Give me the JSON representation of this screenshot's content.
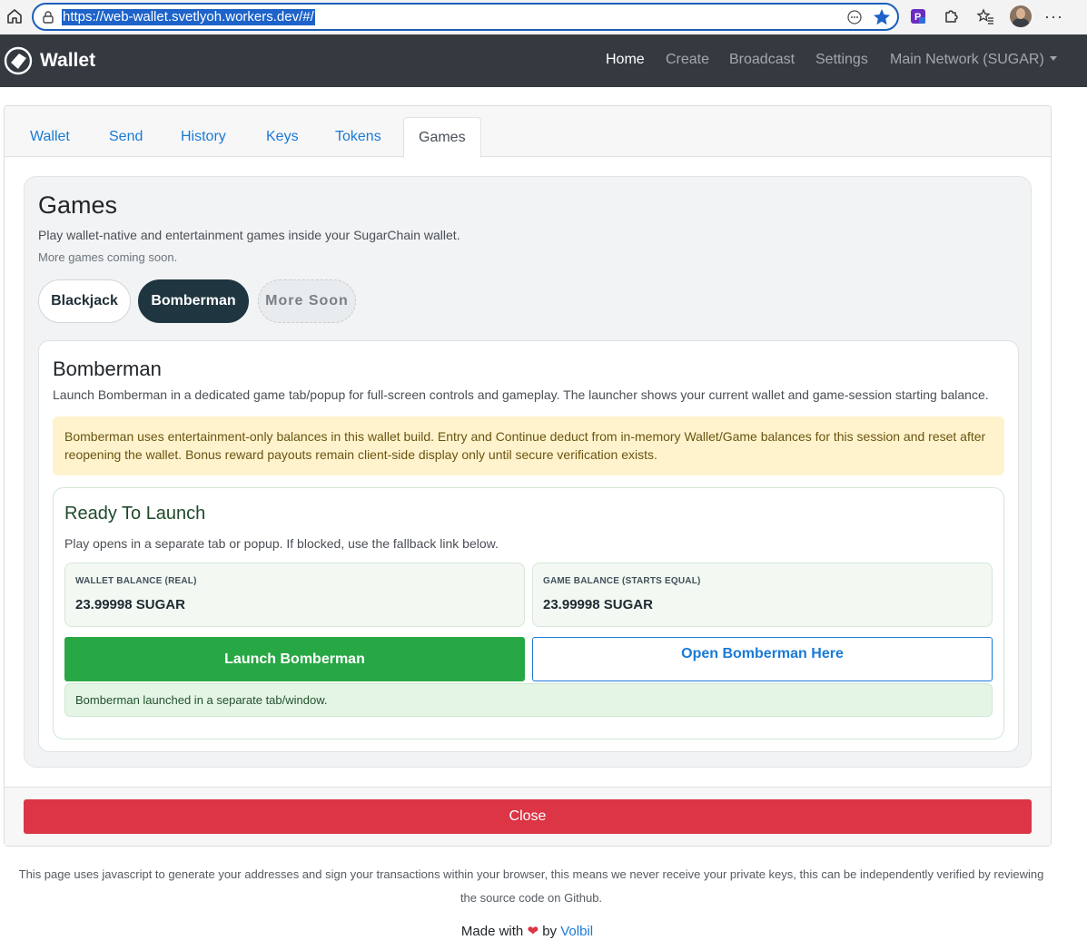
{
  "browser": {
    "url": "https://web-wallet.svetlyoh.workers.dev/#/",
    "icons": [
      "home-icon",
      "lock-icon",
      "reader-icon",
      "favorite-star-icon",
      "extension-p-icon",
      "puzzle-icon",
      "favorites-icon",
      "profile-avatar",
      "more-icon"
    ],
    "more_label": "···"
  },
  "navbar": {
    "brand": "Wallet",
    "items": [
      "Home",
      "Create",
      "Broadcast",
      "Settings"
    ],
    "network": "Main Network (SUGAR)"
  },
  "tabs": [
    "Wallet",
    "Send",
    "History",
    "Keys",
    "Tokens",
    "Games"
  ],
  "games": {
    "title": "Games",
    "subtitle": "Play wallet-native and entertainment games inside your SugarChain wallet.",
    "note": "More games coming soon.",
    "pills": [
      "Blackjack",
      "Bomberman",
      "More Soon"
    ]
  },
  "bomberman": {
    "title": "Bomberman",
    "description": "Launch Bomberman in a dedicated game tab/popup for full-screen controls and gameplay. The launcher shows your current wallet and game-session starting balance.",
    "warning": "Bomberman uses entertainment-only balances in this wallet build. Entry and Continue deduct from in-memory Wallet/Game balances for this session and reset after reopening the wallet. Bonus reward payouts remain client-side display only until secure verification exists.",
    "launch": {
      "title": "Ready To Launch",
      "subtitle": "Play opens in a separate tab or popup. If blocked, use the fallback link below.",
      "wallet_balance_label": "Wallet Balance (Real)",
      "wallet_balance": "23.99998 SUGAR",
      "game_balance_label": "Game Balance (Starts Equal)",
      "game_balance": "23.99998 SUGAR",
      "launch_button": "Launch Bomberman",
      "open_here_button": "Open Bomberman Here",
      "status": "Bomberman launched in a separate tab/window."
    }
  },
  "close_button": "Close",
  "footer": {
    "note": "This page uses javascript to generate your addresses and sign your transactions within your browser, this means we never receive your private keys, this can be independently verified by reviewing the source code on Github.",
    "made_with": "Made with",
    "by": "by",
    "author": "Volbil"
  },
  "colors": {
    "navbar": "#343a40",
    "link": "#1a7ad6",
    "success": "#28a745",
    "danger": "#dc3545",
    "warning_bg": "#fff3cd",
    "active_pill": "#1f3640"
  }
}
